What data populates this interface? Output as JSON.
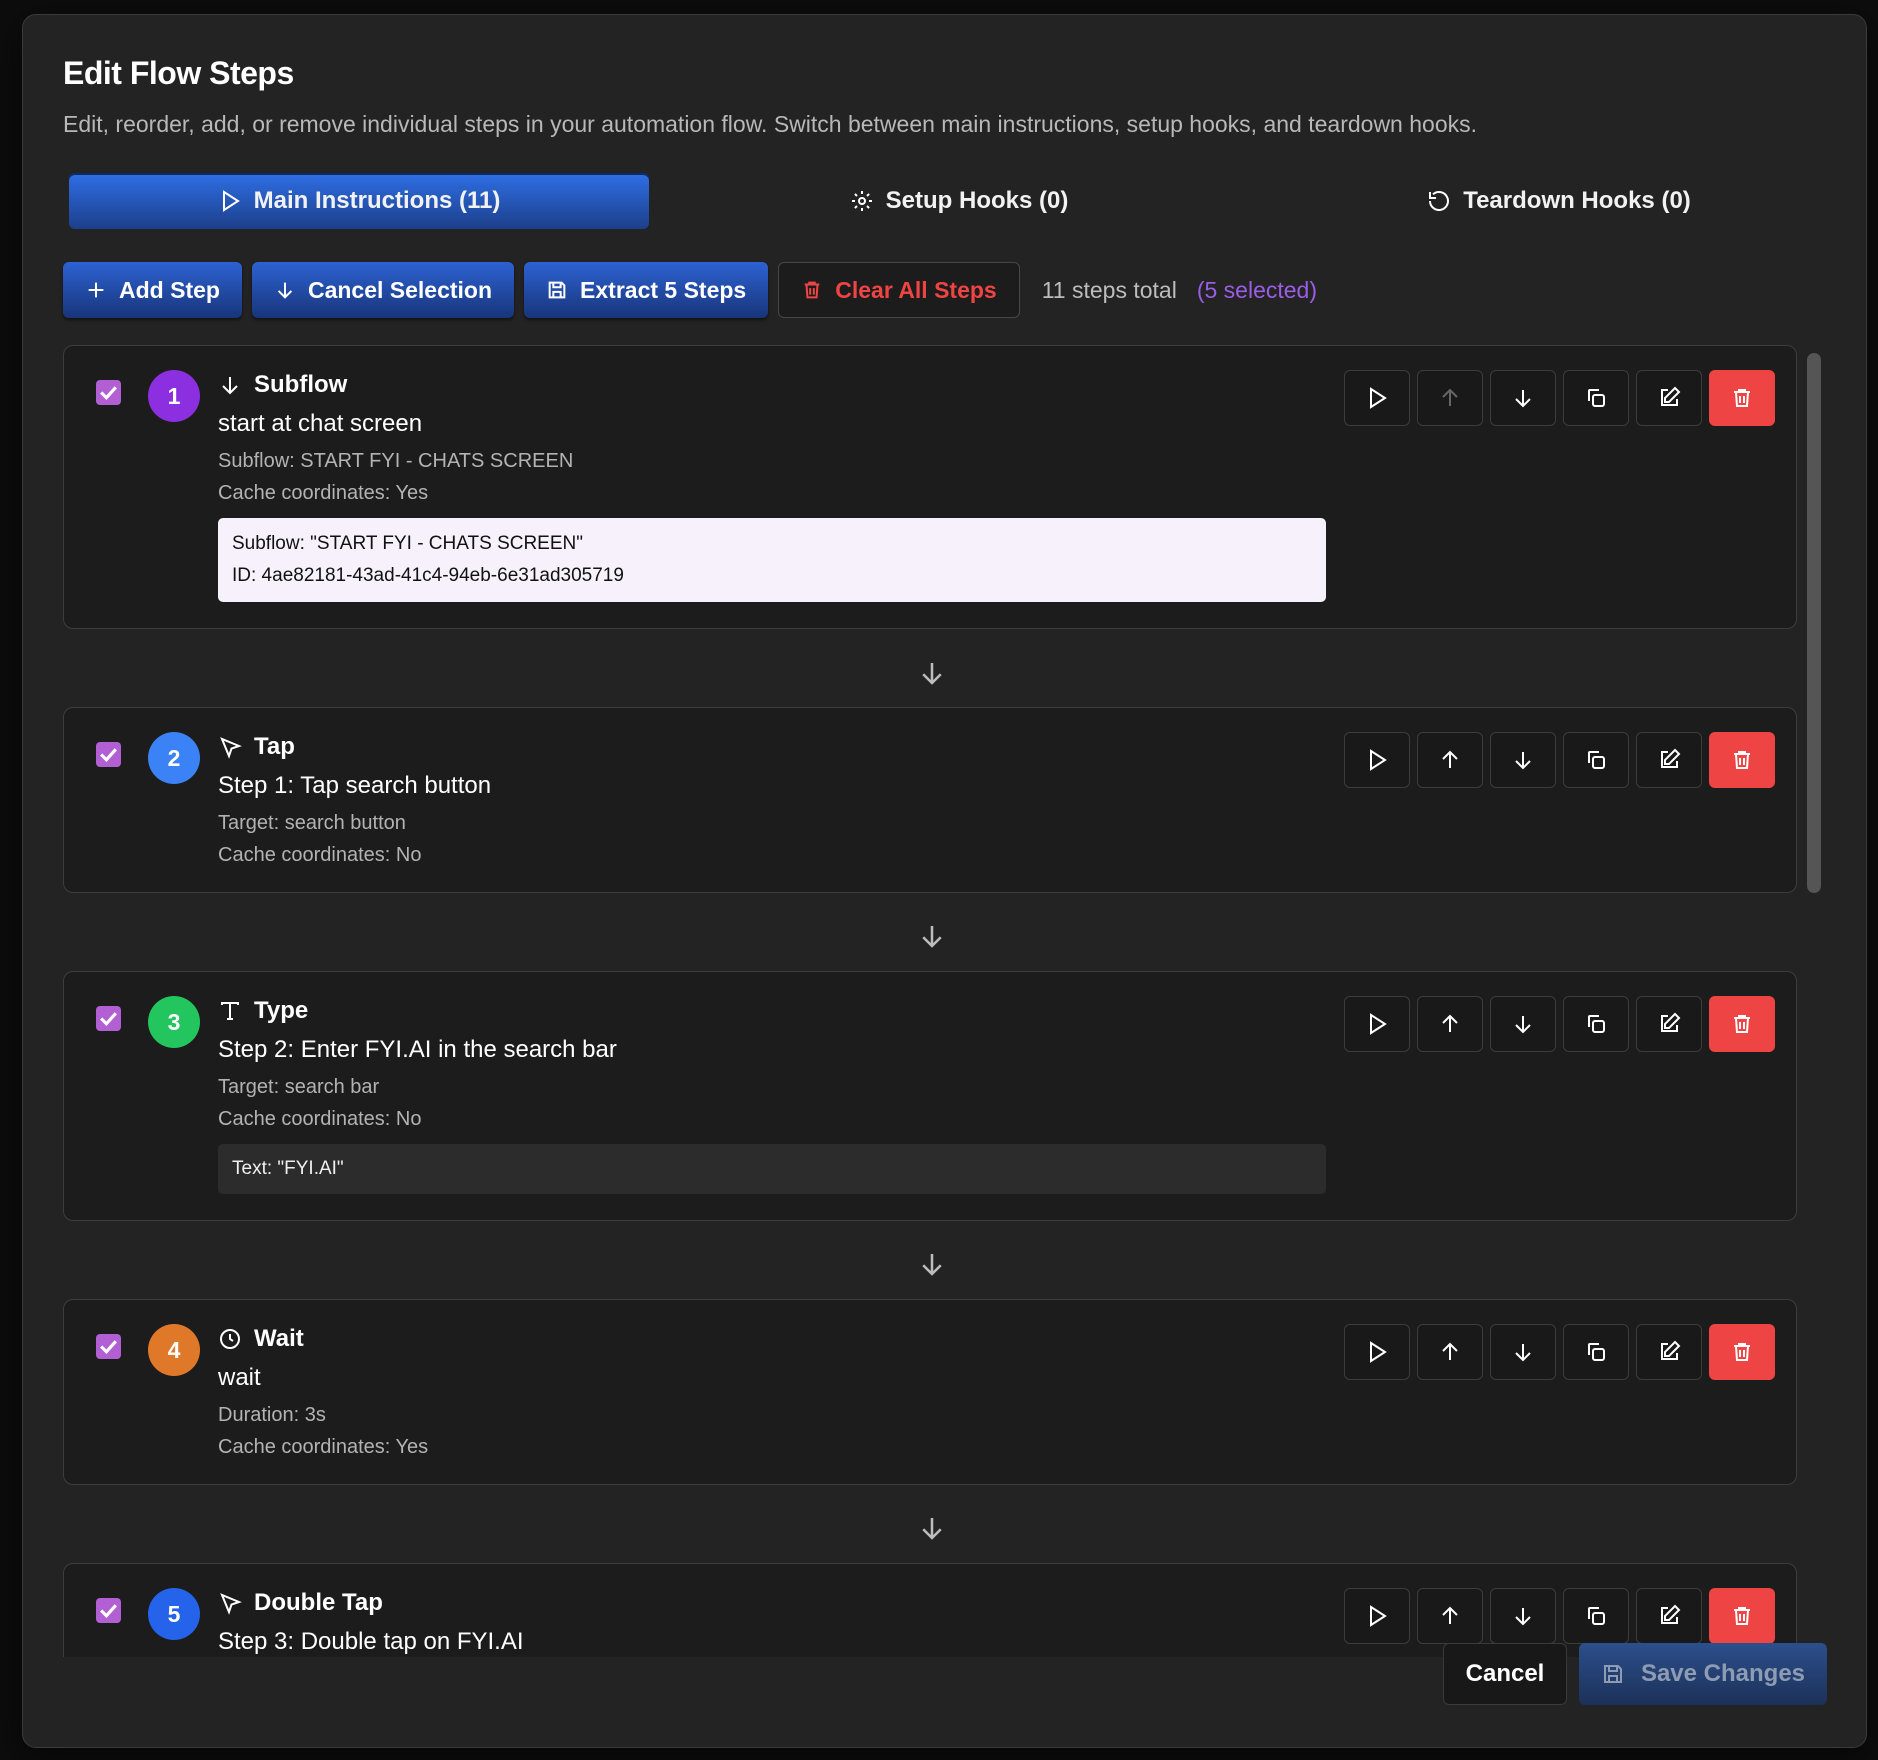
{
  "dialog": {
    "title": "Edit Flow Steps",
    "subtitle": "Edit, reorder, add, or remove individual steps in your automation flow. Switch between main instructions, setup hooks, and teardown hooks."
  },
  "tabs": [
    {
      "label": "Main Instructions (11)",
      "icon": "play-icon",
      "active": true
    },
    {
      "label": "Setup Hooks (0)",
      "icon": "gear-icon",
      "active": false
    },
    {
      "label": "Teardown Hooks (0)",
      "icon": "rotate-ccw-icon",
      "active": false
    }
  ],
  "toolbar": {
    "add_step": "Add Step",
    "cancel_selection": "Cancel Selection",
    "extract_steps": "Extract 5 Steps",
    "clear_all": "Clear All Steps",
    "steps_total": "11 steps total",
    "selected_count": "(5 selected)"
  },
  "colors": {
    "accent_blue": "#2d62d3",
    "danger_red": "#ef4444",
    "checkbox_purple": "#b15fd3",
    "selected_purple": "#9b5de5"
  },
  "steps": [
    {
      "number": "1",
      "color": "#8b2fe0",
      "type": "Subflow",
      "icon": "arrow-down-icon",
      "description": "start at chat screen",
      "meta": [
        "Subflow: START FYI - CHATS SCREEN",
        "Cache coordinates: Yes"
      ],
      "detail": [
        "Subflow: \"START FYI - CHATS SCREEN\"",
        "ID: 4ae82181-43ad-41c4-94eb-6e31ad305719"
      ],
      "checked": true
    },
    {
      "number": "2",
      "color": "#3b82f6",
      "type": "Tap",
      "icon": "cursor-pointer-icon",
      "description": "Step 1: Tap search button",
      "meta": [
        "Target: search button",
        "Cache coordinates: No"
      ],
      "checked": true
    },
    {
      "number": "3",
      "color": "#22c55e",
      "type": "Type",
      "icon": "text-type-icon",
      "description": "Step 2: Enter FYI.AI in the search bar",
      "meta": [
        "Target: search bar",
        "Cache coordinates: No"
      ],
      "detail": [
        "Text: \"FYI.AI\""
      ],
      "checked": true
    },
    {
      "number": "4",
      "color": "#e0782a",
      "type": "Wait",
      "icon": "clock-icon",
      "description": "wait",
      "meta": [
        "Duration: 3s",
        "Cache coordinates: Yes"
      ],
      "checked": true
    },
    {
      "number": "5",
      "color": "#2563eb",
      "type": "Double Tap",
      "icon": "cursor-pointer-icon",
      "description": "Step 3: Double tap on FYI.AI",
      "meta": [],
      "checked": true
    }
  ],
  "footer": {
    "cancel": "Cancel",
    "save": "Save Changes"
  }
}
